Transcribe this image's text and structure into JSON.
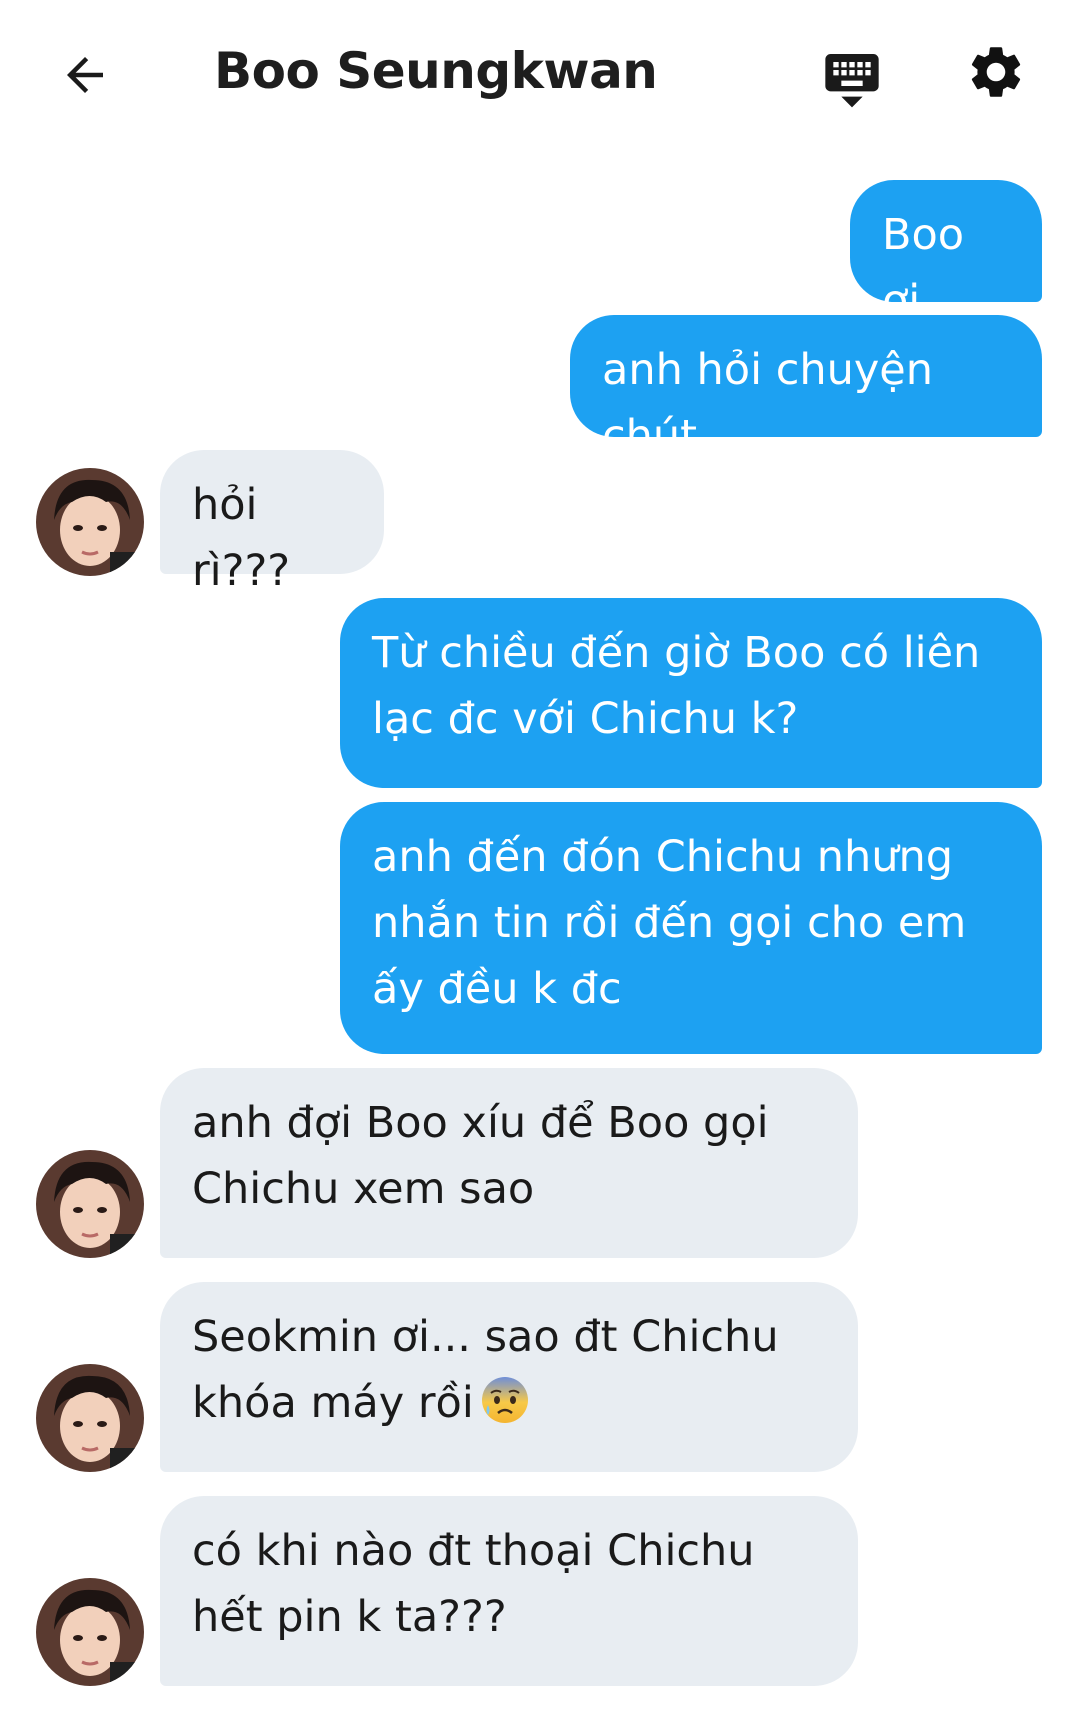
{
  "header": {
    "title": "Boo Seungkwan",
    "back_icon": "arrow-left-icon",
    "keyboard_icon": "keyboard-icon",
    "settings_icon": "gear-icon"
  },
  "colors": {
    "sent_bubble": "#1da1f2",
    "received_bubble": "#e8edf2",
    "text_dark": "#1a1a1a"
  },
  "messages": [
    {
      "from": "me",
      "text": "Boo ơi"
    },
    {
      "from": "me",
      "text": "anh hỏi chuyện chút"
    },
    {
      "from": "contact",
      "text": "hỏi rì???"
    },
    {
      "from": "me",
      "text": "Từ chiều đến giờ Boo có liên lạc đc với Chichu k?"
    },
    {
      "from": "me",
      "text": "anh đến đón Chichu nhưng nhắn tin rồi đến gọi cho em ấy đều k đc"
    },
    {
      "from": "contact",
      "text": "anh đợi Boo xíu để Boo gọi Chichu xem sao"
    },
    {
      "from": "contact",
      "text": "Seokmin ơi... sao đt Chichu khóa máy rồi",
      "emoji": "anxious-face-with-sweat-icon"
    },
    {
      "from": "contact",
      "text": "có khi nào đt thoại Chichu hết pin k ta???"
    }
  ]
}
